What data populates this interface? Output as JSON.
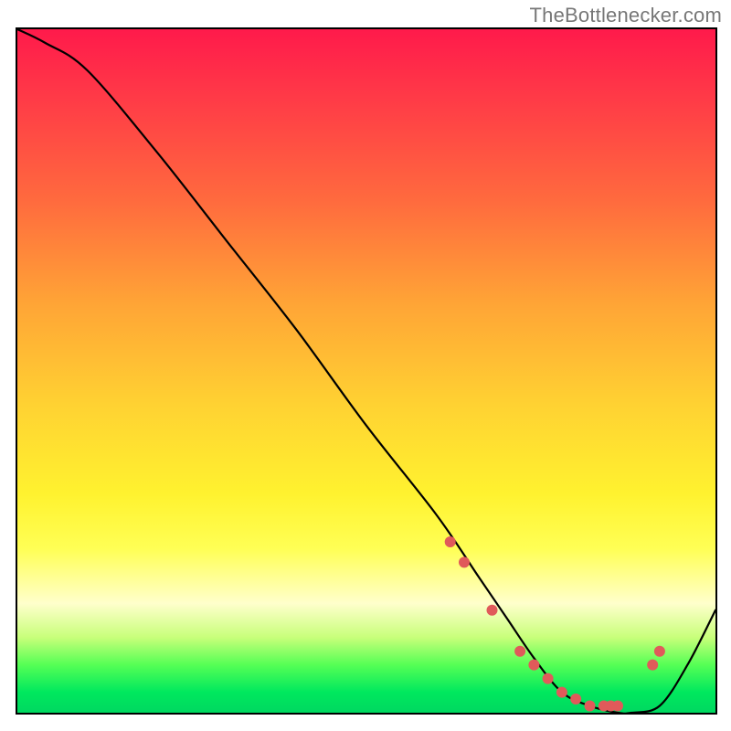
{
  "attribution": "TheBottlenecker.com",
  "chart_data": {
    "type": "line",
    "title": "",
    "xlabel": "",
    "ylabel": "",
    "xlim": [
      0,
      100
    ],
    "ylim": [
      0,
      100
    ],
    "series": [
      {
        "name": "bottleneck-curve",
        "x": [
          0,
          4,
          10,
          20,
          30,
          40,
          50,
          60,
          66,
          70,
          74,
          78,
          82,
          86,
          88,
          92,
          96,
          100
        ],
        "values": [
          100,
          98,
          94,
          82,
          69,
          56,
          42,
          29,
          20,
          14,
          8,
          3,
          1,
          0,
          0,
          1,
          7,
          15
        ]
      }
    ],
    "markers": {
      "name": "highlight-dots",
      "x": [
        62,
        64,
        68,
        72,
        74,
        76,
        78,
        80,
        82,
        84,
        85,
        86,
        91,
        92
      ],
      "values": [
        25,
        22,
        15,
        9,
        7,
        5,
        3,
        2,
        1,
        1,
        1,
        1,
        7,
        9
      ],
      "color": "#e05a5a",
      "radius": 6
    },
    "gradient_stops": [
      {
        "pos": 0,
        "color": "#ff1a4b"
      },
      {
        "pos": 25,
        "color": "#ff6a3e"
      },
      {
        "pos": 55,
        "color": "#ffd232"
      },
      {
        "pos": 76,
        "color": "#ffff55"
      },
      {
        "pos": 93,
        "color": "#55ff55"
      },
      {
        "pos": 100,
        "color": "#00d860"
      }
    ]
  }
}
